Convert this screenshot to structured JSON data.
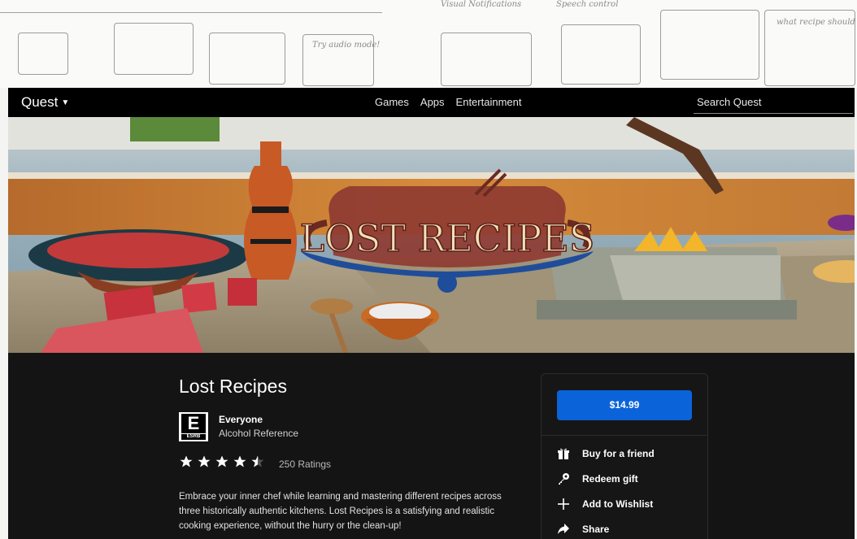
{
  "nav": {
    "brand": "Quest",
    "links": [
      "Games",
      "Apps",
      "Entertainment"
    ],
    "search_placeholder": "Search Quest"
  },
  "hero": {
    "logo_text": "LOST RECIPES"
  },
  "product": {
    "title": "Lost Recipes",
    "esrb_letter": "E",
    "esrb_label": "ESRB",
    "rating_name": "Everyone",
    "rating_descriptor": "Alcohol Reference",
    "stars": 4.5,
    "ratings_count": "250 Ratings",
    "description": "Embrace your inner chef while learning and mastering different recipes across three historically authentic kitchens. Lost Recipes is a satisfying and realistic cooking experience, without the hurry or the clean-up!"
  },
  "purchase": {
    "price": "$14.99",
    "actions": [
      {
        "label": "Buy for a friend",
        "icon": "gift-icon"
      },
      {
        "label": "Redeem gift",
        "icon": "key-icon"
      },
      {
        "label": "Add to Wishlist",
        "icon": "plus-icon"
      },
      {
        "label": "Share",
        "icon": "share-icon"
      }
    ]
  },
  "sketches": {
    "notes": [
      "Visual Notifications",
      "Speech control",
      "Try audio mode!",
      "what recipe should I do?"
    ]
  },
  "colors": {
    "accent": "#0b63d9",
    "background": "#141414",
    "navbar": "#000000"
  }
}
